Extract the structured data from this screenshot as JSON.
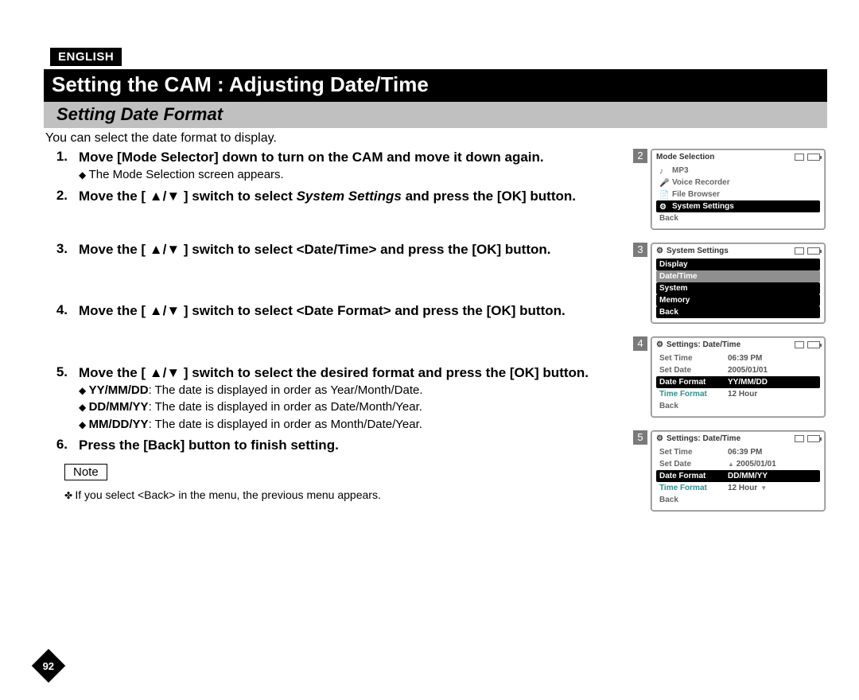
{
  "header": {
    "lang_tag": "ENGLISH",
    "title": "Setting the CAM : Adjusting Date/Time",
    "subtitle": "Setting Date Format"
  },
  "intro": "You can select the date format to display.",
  "steps": [
    {
      "num": "1.",
      "main_pre": "Move [Mode Selector] down to turn on the CAM and move it down again.",
      "subs": [
        "The Mode Selection screen appears."
      ]
    },
    {
      "num": "2.",
      "main_pre": "Move the [ ▲/▼ ] switch to select ",
      "main_em": "System Settings",
      "main_post": " and press the [OK] button.",
      "gap_after": "sm"
    },
    {
      "num": "3.",
      "main_pre": "Move the [ ▲/▼ ] switch to select <Date/Time> and press the [OK] button.",
      "gap_after": "md"
    },
    {
      "num": "4.",
      "main_pre": "Move the [ ▲/▼ ] switch to select <Date Format> and press the [OK] button.",
      "gap_after": "md"
    },
    {
      "num": "5.",
      "main_pre": "Move the [ ▲/▼ ] switch to select the desired format and press the [OK] button.",
      "subs_kv": [
        {
          "k": "YY/MM/DD",
          "v": ": The date is displayed in order as Year/Month/Date."
        },
        {
          "k": "DD/MM/YY",
          "v": ": The date is displayed in order as Date/Month/Year."
        },
        {
          "k": "MM/DD/YY",
          "v": ": The date is displayed in order as Month/Date/Year."
        }
      ]
    },
    {
      "num": "6.",
      "main_pre": "Press the [Back] button to finish setting."
    }
  ],
  "note": {
    "label": "Note",
    "line": "If you select <Back> in the menu, the previous menu appears."
  },
  "page_number": "92",
  "screens": [
    {
      "num": "2",
      "title": "Mode Selection",
      "rows": [
        {
          "icon": "♪",
          "label": "MP3"
        },
        {
          "icon": "🎤",
          "label": "Voice Recorder"
        },
        {
          "icon": "📄",
          "label": "File Browser"
        },
        {
          "icon": "⚙",
          "label": "System Settings",
          "sel": "black"
        },
        {
          "label": "Back"
        }
      ]
    },
    {
      "num": "3",
      "title": "System Settings",
      "title_icon": "⚙",
      "rows": [
        {
          "label": "Display",
          "sel": "black"
        },
        {
          "label": "Date/Time",
          "sel": "gray"
        },
        {
          "label": "System",
          "sel": "black"
        },
        {
          "label": "Memory",
          "sel": "black"
        },
        {
          "label": "Back",
          "sel": "black"
        }
      ]
    },
    {
      "num": "4",
      "title": "Settings: Date/Time",
      "title_icon": "⚙",
      "two_col": true,
      "rows": [
        {
          "label": "Set Time",
          "value": "06:39 PM"
        },
        {
          "label": "Set Date",
          "value": "2005/01/01"
        },
        {
          "label": "Date Format",
          "value": "YY/MM/DD",
          "sel": "black"
        },
        {
          "label": "Time Format",
          "value": "12 Hour",
          "teal": true
        },
        {
          "label": "Back"
        }
      ]
    },
    {
      "num": "5",
      "title": "Settings: Date/Time",
      "title_icon": "⚙",
      "two_col": true,
      "rows": [
        {
          "label": "Set Time",
          "value": "06:39 PM"
        },
        {
          "label": "Set Date",
          "value": "2005/01/01",
          "tri": "up"
        },
        {
          "label": "Date Format",
          "value": "DD/MM/YY",
          "sel": "black"
        },
        {
          "label": "Time Format",
          "value": "12 Hour",
          "teal": true,
          "tri": "down"
        },
        {
          "label": "Back"
        }
      ]
    }
  ]
}
